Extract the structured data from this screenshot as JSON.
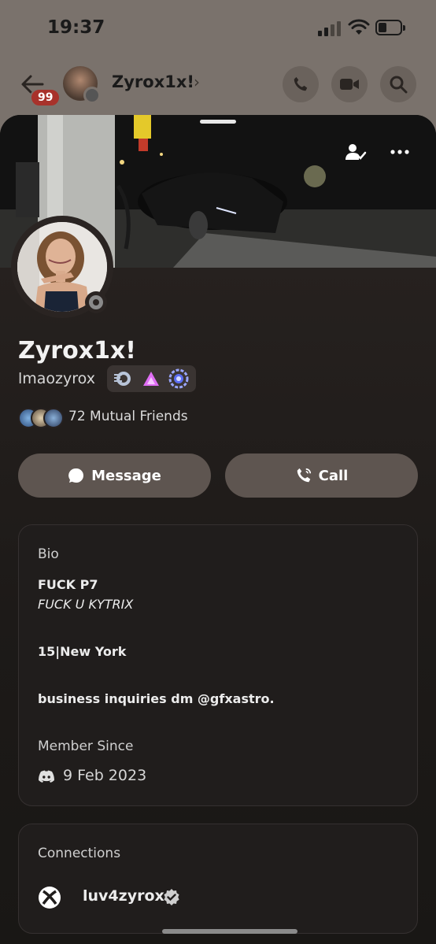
{
  "status_bar": {
    "time": "19:37"
  },
  "header": {
    "unread_count": "99",
    "name": "Zyrox1x!",
    "chevron": "›"
  },
  "profile": {
    "display_name": "Zyrox1x!",
    "username": "lmaozyrox",
    "mutual_friends": "72 Mutual Friends",
    "badges": [
      "hypesquad-icon",
      "nitro-triangle-icon",
      "quest-badge-icon"
    ]
  },
  "actions": {
    "message_label": "Message",
    "call_label": "Call"
  },
  "bio": {
    "heading": "Bio",
    "line1": "FUCK P7",
    "line2": "FUCK U KYTRIX",
    "line3": "15|New York",
    "line4": "business inquiries dm @gfxastro.",
    "member_since_label": "Member Since",
    "member_since_value": "9 Feb 2023"
  },
  "connections": {
    "heading": "Connections",
    "items": [
      {
        "service_icon": "xbox-icon",
        "name": "luv4zyrox",
        "verified": true
      }
    ]
  },
  "colors": {
    "sheet_bg": "#1d1a18",
    "button_bg": "#5e5550",
    "badge_red": "#a8322b"
  }
}
